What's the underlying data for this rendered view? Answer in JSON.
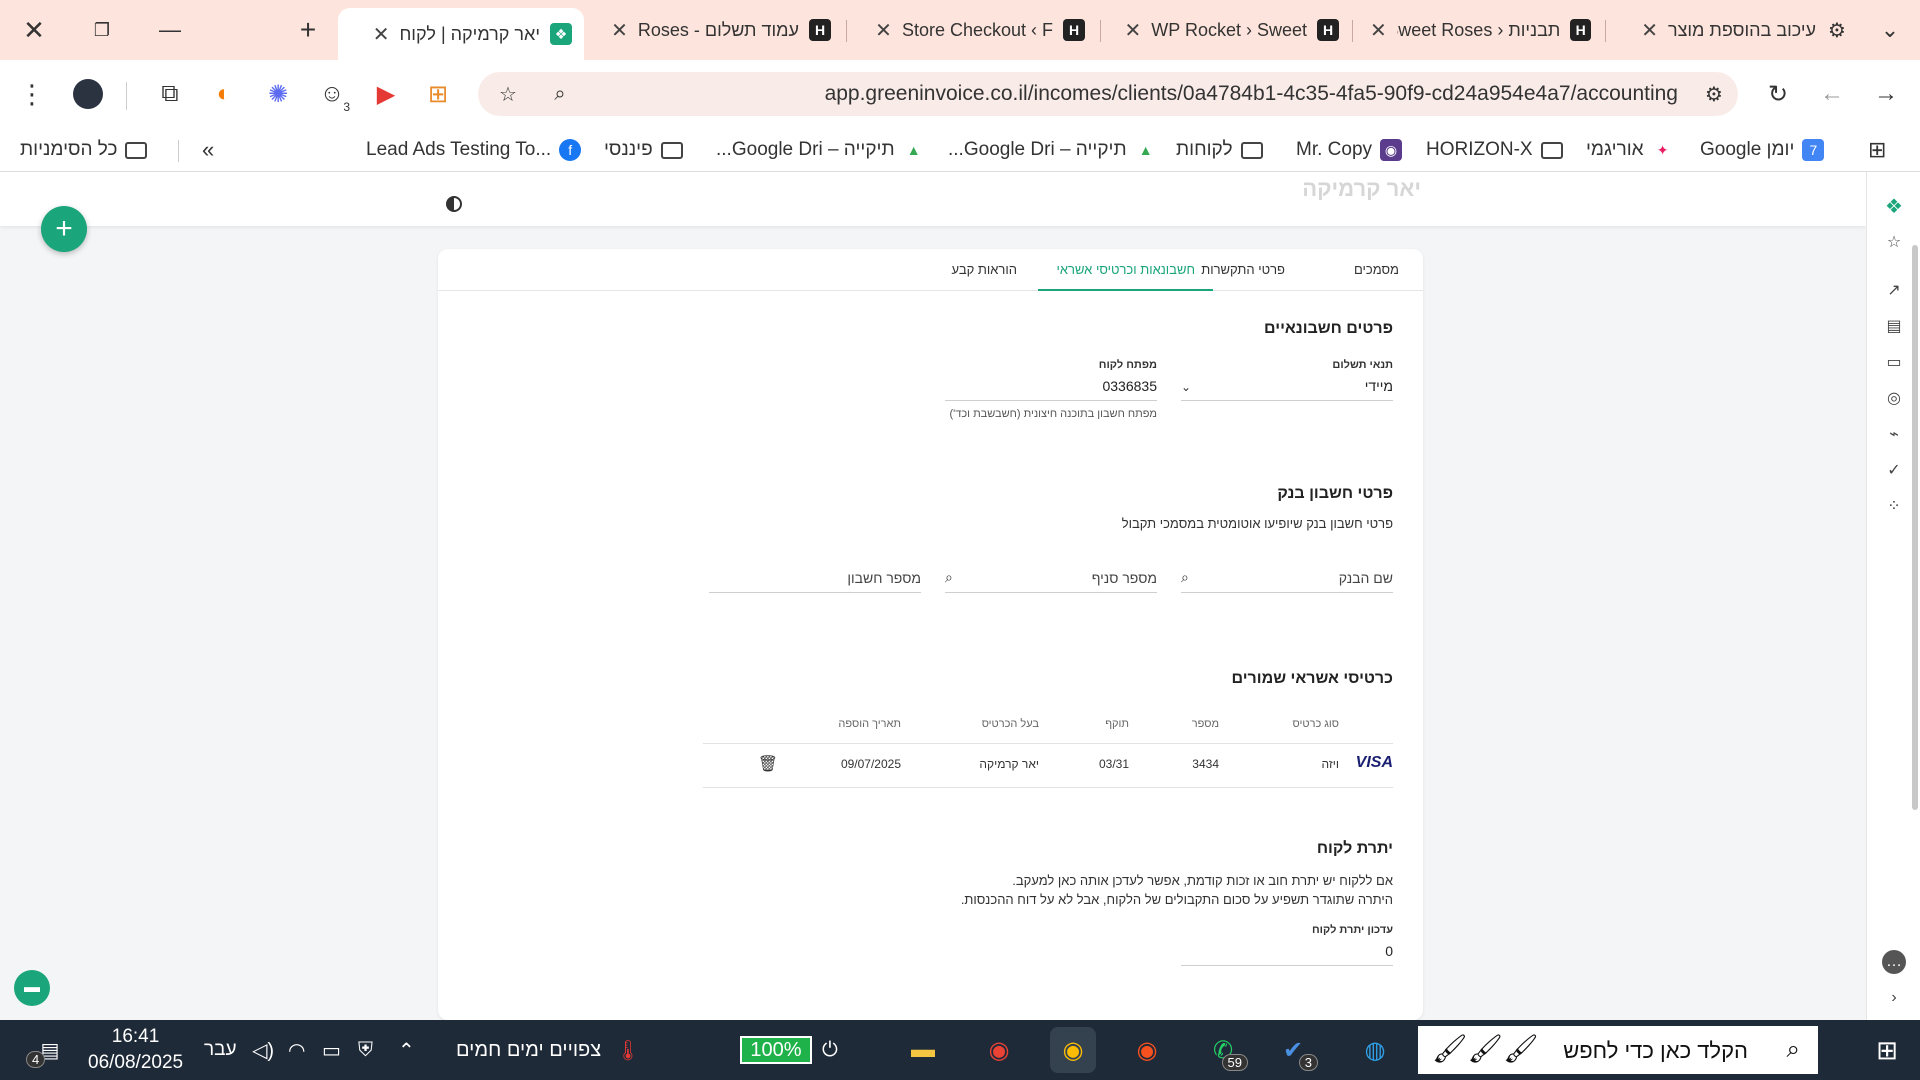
{
  "browser": {
    "tabs": [
      {
        "title": "יאר קרמיקה | לקוח",
        "favicon": "greeninvoice-icon",
        "active": true
      },
      {
        "title": "עמוד תשלום - Roses",
        "favicon": "hostinger-icon"
      },
      {
        "title": "Store Checkout ‹ F",
        "favicon": "hostinger-icon"
      },
      {
        "title": "WP Rocket › Sweet",
        "favicon": "hostinger-icon"
      },
      {
        "title": "תבניות ‹ Sweet Roses",
        "favicon": "hostinger-icon"
      },
      {
        "title": "עיכוב בהוספת מוצר",
        "favicon": "chatgpt-icon"
      }
    ],
    "url": "app.greeninvoice.co.il/incomes/clients/0a4784b1-4c35-4fa5-90f9-cd24a954e4a7/accounting",
    "extension_badge": "3",
    "bookmarks": [
      {
        "label": "יומן Google",
        "icon": "calendar-icon",
        "color": "#4285f4"
      },
      {
        "label": "אוריגמי",
        "icon": "origami-icon",
        "color": "#e91e63"
      },
      {
        "label": "HORIZON-X",
        "icon": "folder-icon"
      },
      {
        "label": "Mr. Copy",
        "icon": "mrcopy-icon",
        "color": "#5b3b8c"
      },
      {
        "label": "לקוחות",
        "icon": "folder-icon"
      },
      {
        "label": "תיקייה – Google Dri...",
        "icon": "google-drive-icon"
      },
      {
        "label": "תיקייה – Google Dri...",
        "icon": "google-drive-icon"
      },
      {
        "label": "פיננסי",
        "icon": "folder-icon"
      },
      {
        "label": "Lead Ads Testing To...",
        "icon": "facebook-icon",
        "color": "#1877f2"
      }
    ],
    "all_bookmarks": "כל הסימניות"
  },
  "app": {
    "client_name": "יאר קרמיקה",
    "tabs": [
      "מסמכים",
      "פרטי התקשרות",
      "חשבונאות וכרטיסי אשראי",
      "הוראות קבע"
    ],
    "active_tab": "חשבונאות וכרטיסי אשראי",
    "accounting": {
      "title": "פרטים חשבונאיים",
      "payment_terms_label": "תנאי תשלום",
      "payment_terms_value": "מיידי",
      "customer_key_label": "מפתח לקוח",
      "customer_key_value": "0336835",
      "customer_key_hint": "מפתח חשבון בתוכנה חיצונית (חשבשבת וכד')"
    },
    "bank": {
      "title": "פרטי חשבון בנק",
      "description": "פרטי חשבון בנק שיופיעו אוטומטית במסמכי תקבול",
      "bank_name_placeholder": "שם הבנק",
      "branch_placeholder": "מספר סניף",
      "account_placeholder": "מספר חשבון"
    },
    "cards": {
      "title": "כרטיסי אשראי שמורים",
      "columns": [
        "סוג כרטיס",
        "מספר",
        "תוקף",
        "בעל הכרטיס",
        "תאריך הוספה"
      ],
      "rows": [
        {
          "brand_logo": "VISA",
          "type": "ויזה",
          "number": "3434",
          "expiry": "03/31",
          "holder": "יאר קרמיקה",
          "added": "09/07/2025"
        }
      ]
    },
    "balance": {
      "title": "יתרת לקוח",
      "description_line1": "אם ללקוח יש יתרת חוב או זכות קודמת, אפשר לעדכן אותה כאן למעקב.",
      "description_line2": "היתרה שתוגדר תשפיע על סכום התקבולים של הלקוח, אבל לא על דוח ההכנסות.",
      "update_label": "עדכון יתרת לקוח",
      "update_value": "0"
    }
  },
  "taskbar": {
    "search_placeholder": "הקלד כאן כדי לחפש",
    "weather": "צפויים ימים חמים",
    "battery": "100%",
    "language": "עבר",
    "time": "16:41",
    "date": "06/08/2025",
    "notification_count": "4",
    "whatsapp_badge": "59",
    "todo_badge": "3"
  },
  "colors": {
    "brand_green": "#1aa57a",
    "tab_bar": "#fde4dc",
    "taskbar": "#1f2a38"
  }
}
